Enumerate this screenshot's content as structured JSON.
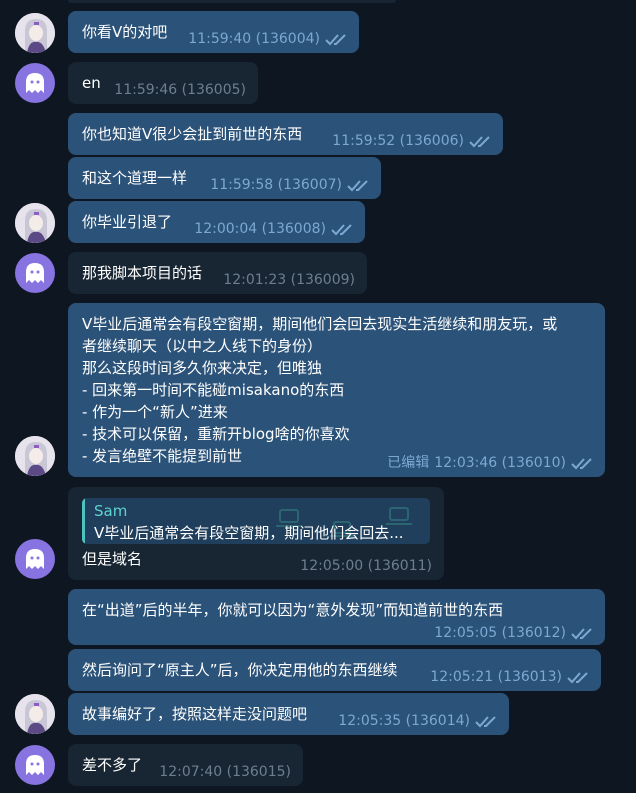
{
  "colors": {
    "background": "#0e1621",
    "outgoing_bubble": "#2b5278",
    "incoming_bubble": "#182533",
    "meta_out": "#7da8d3",
    "meta_in": "#6d7f8f",
    "ghost_avatar": "#8774e1",
    "reply_accent": "#4ec4c0"
  },
  "messages": [
    {
      "text": "你看V的对吧",
      "time": "11:59:40 (136004)"
    },
    {
      "text": "en",
      "time": "11:59:46 (136005)"
    },
    {
      "text": "你也知道V很少会扯到前世的东西",
      "time": "11:59:52 (136006)"
    },
    {
      "text": "和这个道理一样",
      "time": "11:59:58 (136007)"
    },
    {
      "text": "你毕业引退了",
      "time": "12:00:04 (136008)"
    },
    {
      "text": "那我脚本项目的话",
      "time": "12:01:23 (136009)"
    },
    {
      "text": "V毕业后通常会有段空窗期，期间他们会回去现实生活继续和朋友玩，或\n者继续聊天（以中之人线下的身份）\n那么这段时间多久你来决定，但唯独\n- 回来第一时间不能碰misakano的东西\n- 作为一个“新人”进来\n- 技术可以保留，重新开blog啥的你喜欢\n- 发言绝壁不能提到前世",
      "edited": "已编辑",
      "time": "12:03:46 (136010)"
    },
    {
      "reply_name": "Sam",
      "reply_text": "V毕业后通常会有段空窗期，期间他们会回去...",
      "text": "但是域名",
      "time": "12:05:00 (136011)"
    },
    {
      "text": "在“出道”后的半年，你就可以因为“意外发现”而知道前世的东西",
      "time": "12:05:05 (136012)"
    },
    {
      "text": "然后询问了“原主人”后，你决定用他的东西继续",
      "time": "12:05:21 (136013)"
    },
    {
      "text": "故事编好了，按照这样走没问题吧",
      "time": "12:05:35 (136014)"
    },
    {
      "text": "差不多了",
      "time": "12:07:40 (136015)"
    }
  ]
}
